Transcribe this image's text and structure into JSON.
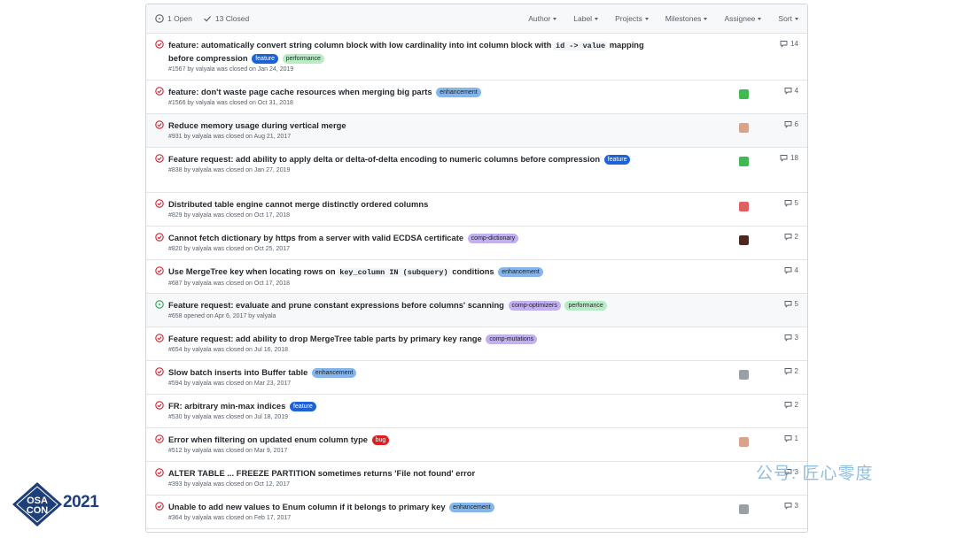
{
  "header": {
    "open_count": "1 Open",
    "closed_count": "13 Closed",
    "filters": [
      "Author",
      "Label",
      "Projects",
      "Milestones",
      "Assignee",
      "Sort"
    ]
  },
  "issues": [
    {
      "state": "closed",
      "title": "feature: automatically convert string column block with low cardinality into int column block with",
      "code": "id -> value",
      "title_after": "mapping before compression",
      "labels": [
        {
          "text": "feature",
          "bg": "#1d63d8",
          "fg": "#ffffff"
        },
        {
          "text": "performance",
          "bg": "#b8ecc4",
          "fg": "#24292e"
        }
      ],
      "meta": "#1567 by valyala was closed on Jan 24, 2019",
      "comments": "14",
      "avatar": null
    },
    {
      "state": "closed",
      "title": "feature: don't waste page cache resources when merging big parts",
      "labels": [
        {
          "text": "enhancement",
          "bg": "#84b6eb",
          "fg": "#1b1f23"
        }
      ],
      "meta": "#1566 by valyala was closed on Oct 31, 2018",
      "comments": "4",
      "avatar": "green"
    },
    {
      "state": "closed",
      "title": "Reduce memory usage during vertical merge",
      "labels": [],
      "meta": "#931 by valyala was closed on Aug 21, 2017",
      "comments": "6",
      "avatar": "face"
    },
    {
      "state": "closed",
      "title": "Feature request: add ability to apply delta or delta-of-delta encoding to numeric columns before compression",
      "labels": [
        {
          "text": "feature",
          "bg": "#1d63d8",
          "fg": "#ffffff"
        }
      ],
      "meta": "#838 by valyala was closed on Jan 27, 2019",
      "comments": "18",
      "avatar": "green"
    },
    {
      "state": "closed",
      "title": "Distributed table engine cannot merge distinctly ordered columns",
      "labels": [],
      "meta": "#829 by valyala was closed on Oct 17, 2018",
      "comments": "5",
      "avatar": "red"
    },
    {
      "state": "closed",
      "title": "Cannot fetch dictionary by https from a server with valid ECDSA certificate",
      "labels": [
        {
          "text": "comp-dictionary",
          "bg": "#c2b0f0",
          "fg": "#1b1f23"
        }
      ],
      "meta": "#820 by valyala was closed on Oct 25, 2017",
      "comments": "2",
      "avatar": "dark"
    },
    {
      "state": "closed",
      "title": "Use MergeTree key when locating rows on",
      "code": "key_column IN (subquery)",
      "title_after": "conditions",
      "labels": [
        {
          "text": "enhancement",
          "bg": "#84b6eb",
          "fg": "#1b1f23"
        }
      ],
      "meta": "#687 by valyala was closed on Oct 17, 2018",
      "comments": "4",
      "avatar": null
    },
    {
      "state": "open",
      "title": "Feature request: evaluate and prune constant expressions before columns' scanning",
      "labels": [
        {
          "text": "comp-optimizers",
          "bg": "#c2b0f0",
          "fg": "#1b1f23"
        },
        {
          "text": "performance",
          "bg": "#b8ecc4",
          "fg": "#24292e"
        }
      ],
      "meta": "#658 opened on Apr 6, 2017 by valyala",
      "comments": "5",
      "avatar": null
    },
    {
      "state": "closed",
      "title": "Feature request: add ability to drop MergeTree table parts by primary key range",
      "labels": [
        {
          "text": "comp-mutations",
          "bg": "#c2b0f0",
          "fg": "#1b1f23"
        }
      ],
      "meta": "#654 by valyala was closed on Jul 16, 2018",
      "comments": "3",
      "avatar": null
    },
    {
      "state": "closed",
      "title": "Slow batch inserts into Buffer table",
      "labels": [
        {
          "text": "enhancement",
          "bg": "#84b6eb",
          "fg": "#1b1f23"
        }
      ],
      "meta": "#594 by valyala was closed on Mar 23, 2017",
      "comments": "2",
      "avatar": "gray"
    },
    {
      "state": "closed",
      "title": "FR: arbitrary min-max indices",
      "labels": [
        {
          "text": "feature",
          "bg": "#1d63d8",
          "fg": "#ffffff"
        }
      ],
      "meta": "#530 by valyala was closed on Jul 18, 2019",
      "comments": "2",
      "avatar": null
    },
    {
      "state": "closed",
      "title": "Error when filtering on updated enum column type",
      "labels": [
        {
          "text": "bug",
          "bg": "#e11d21",
          "fg": "#ffffff"
        }
      ],
      "meta": "#512 by valyala was closed on Mar 9, 2017",
      "comments": "1",
      "avatar": "face"
    },
    {
      "state": "closed",
      "title": "ALTER TABLE ... FREEZE PARTITION sometimes returns 'File not found' error",
      "labels": [],
      "meta": "#393 by valyala was closed on Oct 12, 2017",
      "comments": "3",
      "avatar": null
    },
    {
      "state": "closed",
      "title": "Unable to add new values to Enum column if it belongs to primary key",
      "labels": [
        {
          "text": "enhancement",
          "bg": "#84b6eb",
          "fg": "#1b1f23"
        }
      ],
      "meta": "#364 by valyala was closed on Feb 17, 2017",
      "comments": "3",
      "avatar": "gray"
    }
  ],
  "watermark": "公号: 匠心零度",
  "logo": {
    "letters": "OSA CON",
    "year": "2021"
  },
  "colors": {
    "closed_icon": "#cb2431",
    "open_icon": "#28a745",
    "logo_navy": "#1f3f78"
  }
}
